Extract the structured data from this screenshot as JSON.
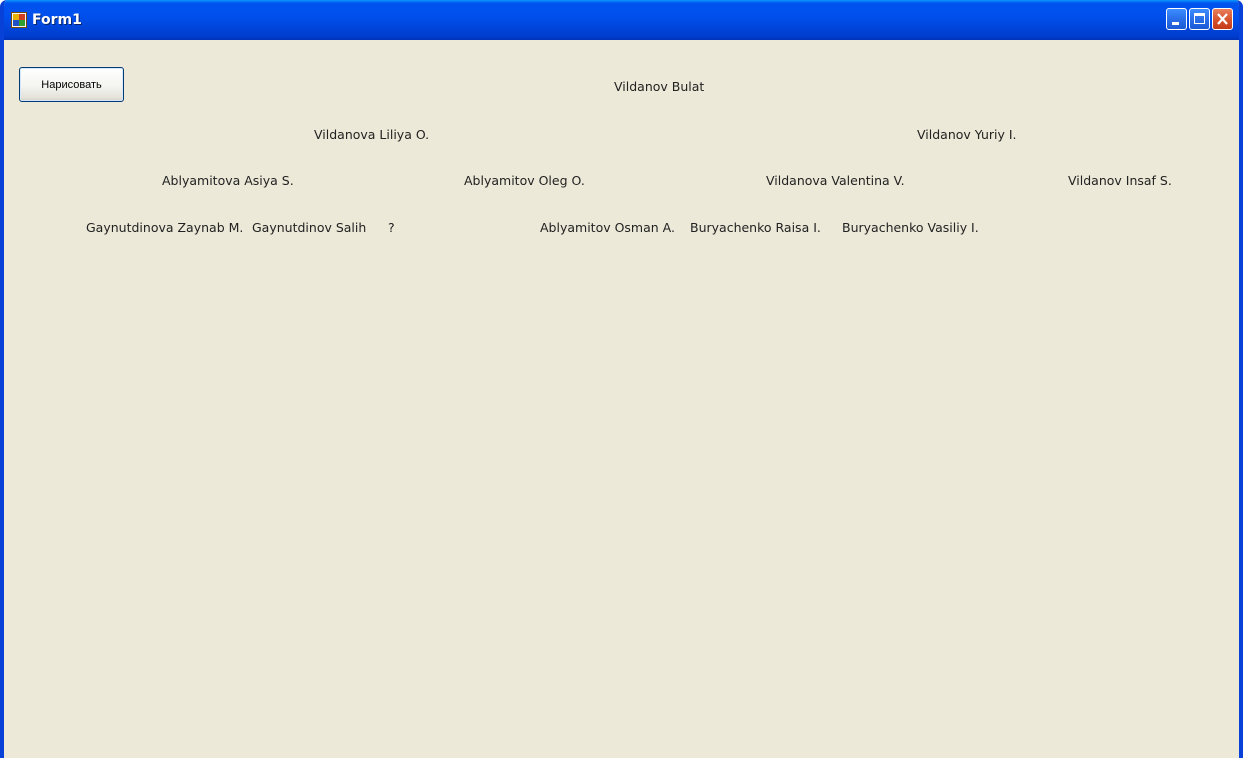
{
  "window": {
    "title": "Form1"
  },
  "form": {
    "draw_button_label": "Нарисовать"
  },
  "tree": {
    "root": "Vildanov Bulat",
    "generation_2": [
      "Vildanova Liliya O.",
      "Vildanov Yuriy I."
    ],
    "generation_3": [
      "Ablyamitova Asiya S.",
      "Ablyamitov Oleg O.",
      "Vildanova Valentina V.",
      "Vildanov Insaf S."
    ],
    "generation_4": [
      "Gaynutdinova Zaynab M.",
      "Gaynutdinov Salih",
      "?",
      "Ablyamitov Osman A.",
      "Buryachenko Raisa I.",
      "Buryachenko Vasiliy I."
    ]
  }
}
